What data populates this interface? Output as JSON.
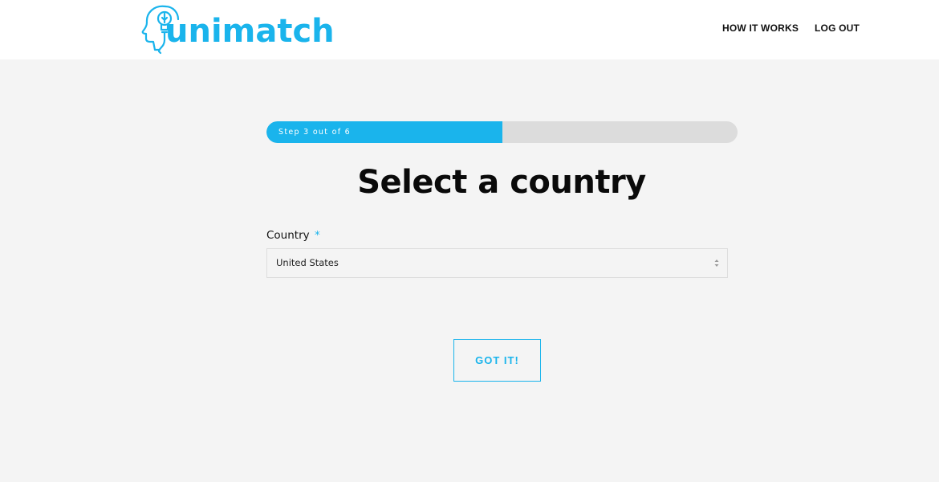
{
  "brand": {
    "name": "unimatch",
    "color": "#1ab4ec",
    "logo_icon": "head-lightbulb-icon"
  },
  "nav": {
    "items": [
      {
        "label": "HOW IT WORKS"
      },
      {
        "label": "LOG OUT"
      }
    ]
  },
  "progress": {
    "label": "Step 3 out of 6",
    "current_step": 3,
    "total_steps": 6,
    "fraction": 0.5,
    "fill_color": "#1ab4ec",
    "track_color": "#dcdcdc"
  },
  "page": {
    "title": "Select a country"
  },
  "form": {
    "country_label": "Country",
    "required_mark": "*",
    "country_value": "United States",
    "select_icon": "updown-arrows-icon"
  },
  "actions": {
    "submit_label": "GOT IT!"
  }
}
